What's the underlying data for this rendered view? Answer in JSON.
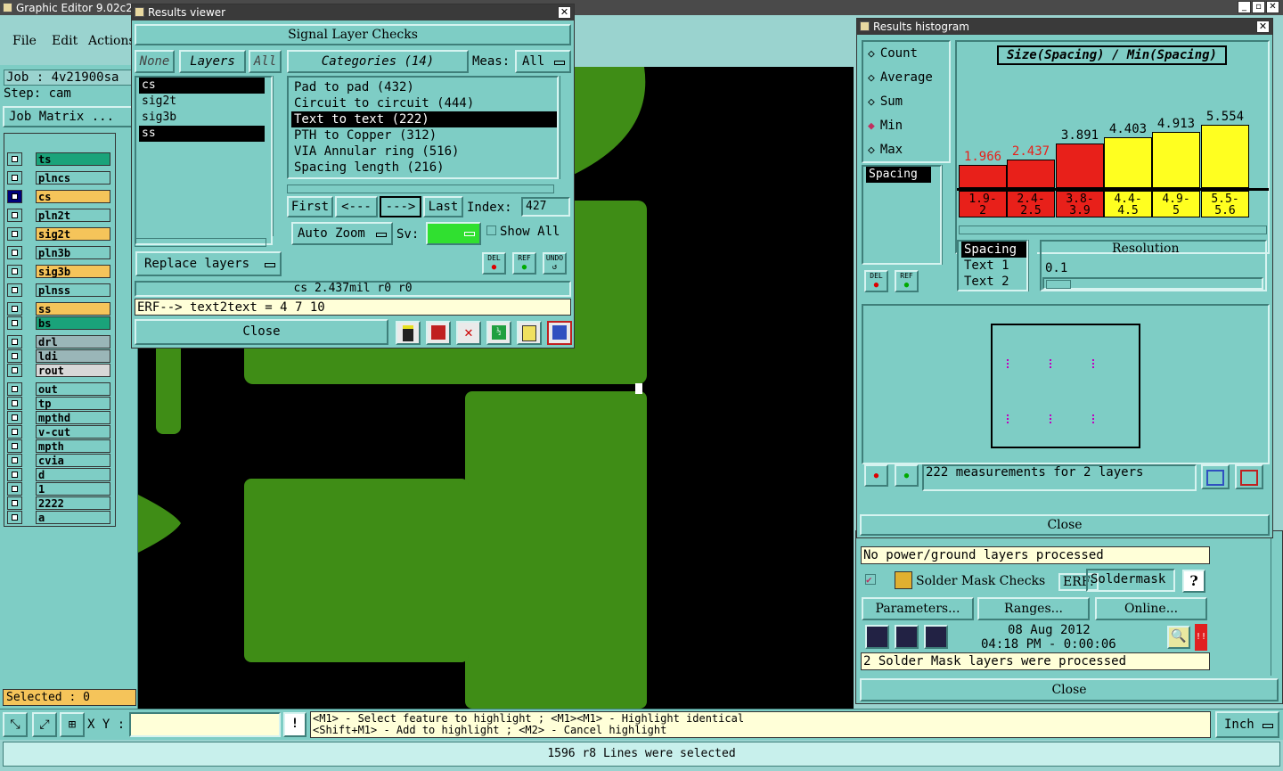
{
  "app": {
    "title": "Graphic Editor 9.02c2 ..."
  },
  "menu": [
    "File",
    "Edit",
    "Actions"
  ],
  "job": {
    "job_label": "Job : 4v21900sa",
    "step_label": "Step: cam",
    "matrix_button": "Job Matrix ..."
  },
  "layers": [
    {
      "name": "ts",
      "color": "#1aa37a"
    },
    {
      "name": "plncs",
      "color": "#7ecdc5"
    },
    {
      "name": "cs",
      "color": "#f5c45a"
    },
    {
      "name": "pln2t",
      "color": "#7ecdc5"
    },
    {
      "name": "sig2t",
      "color": "#f5c45a"
    },
    {
      "name": "pln3b",
      "color": "#7ecdc5"
    },
    {
      "name": "sig3b",
      "color": "#f5c45a"
    },
    {
      "name": "plnss",
      "color": "#7ecdc5"
    },
    {
      "name": "ss",
      "color": "#f5c45a"
    },
    {
      "name": "bs",
      "color": "#1aa37a"
    },
    {
      "name": "drl",
      "color": "#9ab6b8"
    },
    {
      "name": "ldi",
      "color": "#9ab6b8"
    },
    {
      "name": "rout",
      "color": "#d8d8d8"
    },
    {
      "name": "out",
      "color": "#7ecdc5"
    },
    {
      "name": "tp",
      "color": "#7ecdc5"
    },
    {
      "name": "mpthd",
      "color": "#7ecdc5"
    },
    {
      "name": "v-cut",
      "color": "#7ecdc5"
    },
    {
      "name": "mpth",
      "color": "#7ecdc5"
    },
    {
      "name": "cvia",
      "color": "#7ecdc5"
    },
    {
      "name": "d",
      "color": "#7ecdc5"
    },
    {
      "name": "1",
      "color": "#7ecdc5"
    },
    {
      "name": "2222",
      "color": "#7ecdc5"
    },
    {
      "name": "a",
      "color": "#7ecdc5"
    }
  ],
  "selected_status": "Selected : 0",
  "results_viewer": {
    "title": "Results viewer",
    "heading": "Signal Layer Checks",
    "none_btn": "None",
    "layers_btn": "Layers",
    "all_btn": "All",
    "layer_list": [
      "cs",
      "sig2t",
      "sig3b",
      "ss"
    ],
    "categories_btn": "Categories (14)",
    "meas_label": "Meas:",
    "meas_value": "All",
    "categories": [
      "Pad to pad (432)",
      "Circuit to circuit (444)",
      "Text to text (222)",
      "PTH to Copper (312)",
      "VIA Annular ring (516)",
      "Spacing length (216)"
    ],
    "first_btn": "First",
    "prev_btn": "<---",
    "next_btn": "--->",
    "last_btn": "Last",
    "index_label": "Index:",
    "index_value": "427",
    "auto_zoom": "Auto Zoom",
    "sv_label": "Sv:",
    "show_all": "Show All",
    "replace_layers": "Replace layers",
    "del": "DEL",
    "ref": "REF",
    "undo": "UNDO",
    "status": "cs 2.437mil  r0  r0",
    "erf": "ERF--> text2text = 4 7 10",
    "close": "Close"
  },
  "histogram": {
    "title": "Results histogram",
    "modes": [
      "Count",
      "Average",
      "Sum",
      "Min",
      "Max"
    ],
    "selected_mode": "Min",
    "chart_title": "Size(Spacing) / Min(Spacing)",
    "measure_list": [
      "Spacing"
    ],
    "bins": [
      {
        "label": "1.9-\n2",
        "value": "1.966",
        "color": "#e8201a",
        "text_color": "#e8201a"
      },
      {
        "label": "2.4-\n2.5",
        "value": "2.437",
        "color": "#e8201a",
        "text_color": "#e8201a"
      },
      {
        "label": "3.8-\n3.9",
        "value": "3.891",
        "color": "#e8201a",
        "text_color": "#000000"
      },
      {
        "label": "4.4-\n4.5",
        "value": "4.403",
        "color": "#ffff20",
        "text_color": "#000000"
      },
      {
        "label": "4.9-\n5",
        "value": "4.913",
        "color": "#ffff20",
        "text_color": "#000000"
      },
      {
        "label": "5.5-\n5.6",
        "value": "5.554",
        "color": "#ffff20",
        "text_color": "#000000"
      }
    ],
    "resolution_list": [
      "Spacing",
      "Text 1",
      "Text 2"
    ],
    "resolution_label": "Resolution",
    "resolution_value": "0.1",
    "measurements": "222 measurements for 2 layers",
    "close": "Close"
  },
  "checks_panel": {
    "power_status": "No power/ground layers processed",
    "solder_title": "Solder Mask Checks",
    "erf_label": "ERF:",
    "erf_value": "Soldermask",
    "help": "?",
    "parameters_btn": "Parameters...",
    "ranges_btn": "Ranges...",
    "online_btn": "Online...",
    "date": "08 Aug 2012",
    "time": "04:18 PM - 0:00:06",
    "solder_status": "2 Solder Mask layers were processed",
    "close": "Close"
  },
  "bottom": {
    "xy_label": "X Y :",
    "hint1": "<M1> - Select feature to highlight ; <M1><M1> - Highlight identical",
    "hint2": "<Shift+M1> - Add to highlight ; <M2> - Cancel highlight",
    "units": "Inch",
    "status": "1596 r8 Lines were selected"
  }
}
